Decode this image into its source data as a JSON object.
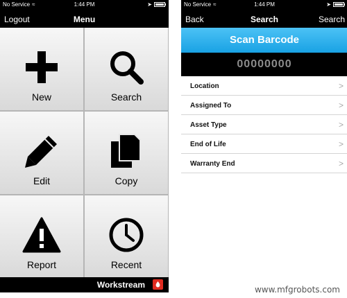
{
  "left_screen": {
    "status_bar": {
      "carrier": "No Service",
      "time": "1:44 PM"
    },
    "nav": {
      "left": "Logout",
      "title": "Menu"
    },
    "tiles": [
      {
        "label": "New",
        "icon": "plus-icon"
      },
      {
        "label": "Search",
        "icon": "magnifier-icon"
      },
      {
        "label": "Edit",
        "icon": "pencil-icon"
      },
      {
        "label": "Copy",
        "icon": "copy-icon"
      },
      {
        "label": "Report",
        "icon": "warning-icon"
      },
      {
        "label": "Recent",
        "icon": "clock-icon"
      }
    ],
    "footer": {
      "brand": "Workstream",
      "logo_color": "#e02b20"
    }
  },
  "right_screen": {
    "status_bar": {
      "carrier": "No Service",
      "time": "1:44 PM"
    },
    "nav": {
      "left": "Back",
      "title": "Search",
      "right": "Search"
    },
    "scan_button": {
      "label": "Scan Barcode",
      "color": "#19a2e4"
    },
    "barcode_value": "00000000",
    "fields": [
      {
        "label": "Location"
      },
      {
        "label": "Assigned To"
      },
      {
        "label": "Asset Type"
      },
      {
        "label": "End of Life"
      },
      {
        "label": "Warranty End"
      }
    ]
  },
  "watermark": "www.mfgrobots.com"
}
